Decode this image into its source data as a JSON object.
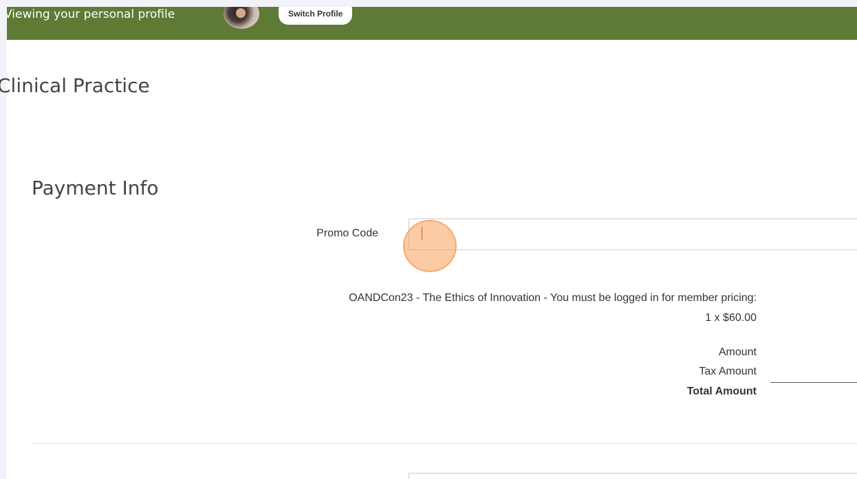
{
  "banner": {
    "viewing_text": "Viewing your personal profile",
    "switch_profile_label": "Switch Profile",
    "color": "#5e7a35"
  },
  "organization": {
    "name": "Clinical Practice"
  },
  "payment": {
    "heading": "Payment Info",
    "promo_code_label": "Promo Code",
    "promo_code_value": "",
    "line_item_description": "OANDCon23 - The Ethics of Innovation - You must be logged in for member pricing:",
    "line_item_quantity_price": "1 x $60.00",
    "amount_label": "Amount",
    "tax_amount_label": "Tax Amount",
    "total_amount_label": "Total Amount"
  }
}
